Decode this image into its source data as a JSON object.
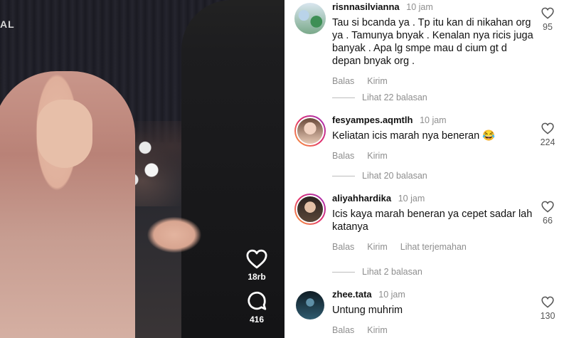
{
  "video": {
    "watermark": "AL",
    "likes_count": "18rb",
    "comments_count": "416"
  },
  "comments": [
    {
      "username": "risnnasilvianna",
      "time": "10 jam",
      "text": "Tau si bcanda ya . Tp itu kan di nikahan org ya . Tamunya bnyak . Kenalan nya ricis juga banyak . Apa lg smpe mau d cium gt d depan bnyak org .",
      "actions": [
        "Balas",
        "Kirim"
      ],
      "likes": "95",
      "replies": "Lihat 22 balasan"
    },
    {
      "username": "fesyampes.aqmtlh",
      "time": "10 jam",
      "text": "Keliatan icis marah nya beneran 😂",
      "actions": [
        "Balas",
        "Kirim"
      ],
      "likes": "224",
      "replies": "Lihat 20 balasan"
    },
    {
      "username": "aliyahhardika",
      "time": "10 jam",
      "text": "Icis kaya marah beneran ya cepet sadar lah katanya",
      "actions": [
        "Balas",
        "Kirim",
        "Lihat terjemahan"
      ],
      "likes": "66",
      "replies": "Lihat 2 balasan"
    },
    {
      "username": "zhee.tata",
      "time": "10 jam",
      "text": "Untung muhrim",
      "actions": [
        "Balas",
        "Kirim"
      ],
      "likes": "130"
    }
  ],
  "colors": {
    "muted": "#8e8e8e",
    "story_ring": [
      "#f9a33b",
      "#e1306c",
      "#9b2fbf"
    ]
  },
  "icons": {
    "video_like": "heart-icon",
    "video_comment": "comment-bubble-icon",
    "comment_like": "heart-outline-icon"
  }
}
